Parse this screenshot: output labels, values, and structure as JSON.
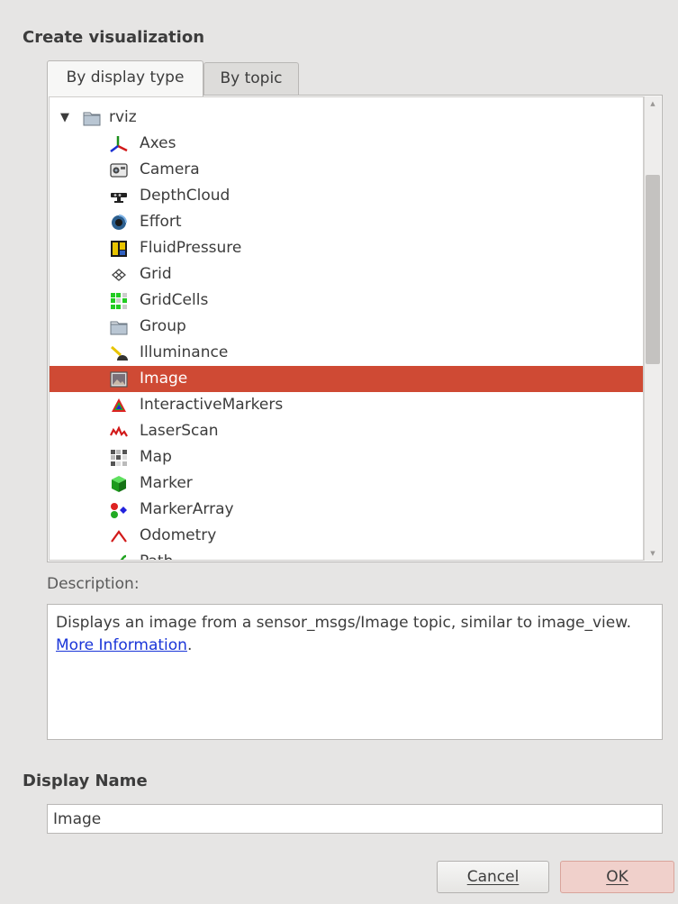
{
  "dialog": {
    "create_heading": "Create visualization",
    "tabs": [
      {
        "label": "By display type",
        "active": true
      },
      {
        "label": "By topic",
        "active": false
      }
    ],
    "tree": {
      "root": {
        "label": "rviz",
        "expanded": true,
        "icon": "folder-icon"
      },
      "items": [
        {
          "label": "Axes",
          "icon": "axes-icon"
        },
        {
          "label": "Camera",
          "icon": "camera-icon"
        },
        {
          "label": "DepthCloud",
          "icon": "depth-sensor-icon"
        },
        {
          "label": "Effort",
          "icon": "effort-icon"
        },
        {
          "label": "FluidPressure",
          "icon": "fluid-pressure-icon"
        },
        {
          "label": "Grid",
          "icon": "grid-icon"
        },
        {
          "label": "GridCells",
          "icon": "grid-cells-icon"
        },
        {
          "label": "Group",
          "icon": "folder-icon"
        },
        {
          "label": "Illuminance",
          "icon": "illuminance-icon"
        },
        {
          "label": "Image",
          "icon": "image-icon",
          "selected": true
        },
        {
          "label": "InteractiveMarkers",
          "icon": "interactive-markers-icon"
        },
        {
          "label": "LaserScan",
          "icon": "laser-scan-icon"
        },
        {
          "label": "Map",
          "icon": "map-icon"
        },
        {
          "label": "Marker",
          "icon": "marker-icon"
        },
        {
          "label": "MarkerArray",
          "icon": "marker-array-icon"
        },
        {
          "label": "Odometry",
          "icon": "odometry-icon"
        },
        {
          "label": "Path",
          "icon": "path-icon"
        }
      ]
    },
    "description_label": "Description:",
    "description": {
      "text_before": "Displays an image from a sensor_msgs/Image topic, similar to image_view. ",
      "link_text": "More Information",
      "text_after": "."
    },
    "display_name_label": "Display Name",
    "display_name_value": "Image",
    "buttons": {
      "cancel_label": "Cancel",
      "ok_label": "OK"
    },
    "colors": {
      "selection": "#cf4a34",
      "link": "#1a35d8",
      "ok_button": "#f0d0cb"
    }
  }
}
